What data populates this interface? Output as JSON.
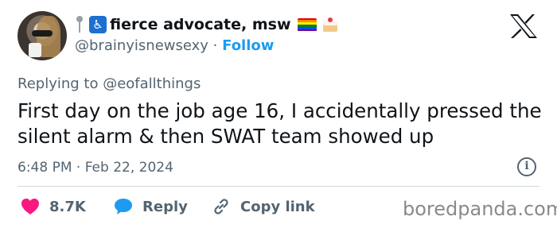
{
  "user": {
    "display_name": "fierce advocate, msw",
    "handle": "@brainyisnewsexy",
    "separator": " · ",
    "follow_label": "Follow",
    "badges": [
      "pin-icon",
      "accessibility-icon",
      "rainbow-flag-icon",
      "cake-icon"
    ]
  },
  "reply_context": {
    "prefix": "Replying to ",
    "mention": "@eofallthings"
  },
  "tweet": {
    "text": "First day on the job age 16, I accidentally pressed the silent alarm & then SWAT team showed up",
    "timestamp": "6:48 PM · Feb 22, 2024"
  },
  "actions": {
    "likes_count": "8.7K",
    "reply_label": "Reply",
    "copy_link_label": "Copy link"
  },
  "colors": {
    "like": "#f91880",
    "reply": "#1d9bf0",
    "follow": "#1d9bf0",
    "secondary_text": "#536471",
    "rainbow": [
      "#e40303",
      "#ff8c00",
      "#ffed00",
      "#008026",
      "#004dff",
      "#750787"
    ]
  },
  "watermark": "boredpanda.com"
}
